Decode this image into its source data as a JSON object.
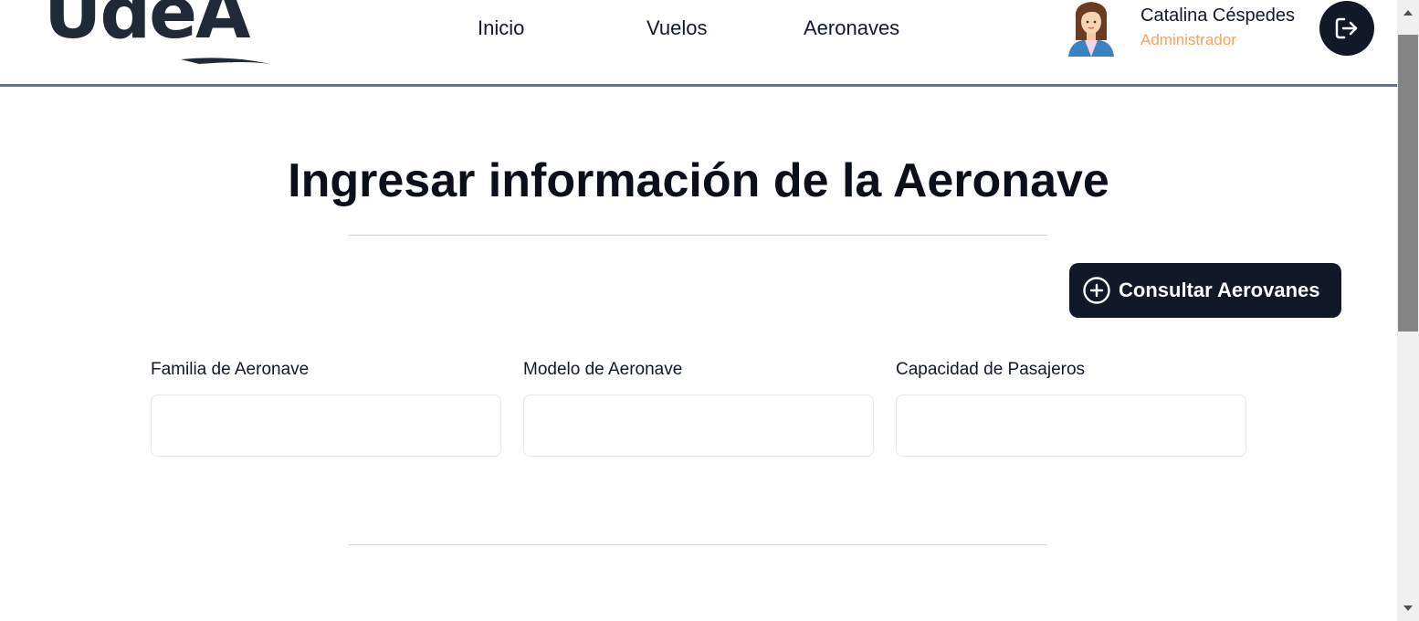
{
  "header": {
    "logo_text": "UdeA",
    "nav": {
      "inicio": "Inicio",
      "vuelos": "Vuelos",
      "aeronaves": "Aeronaves"
    },
    "user": {
      "name": "Catalina Céspedes",
      "role": "Administrador"
    },
    "logout_icon": "logout-icon"
  },
  "main": {
    "title": "Ingresar información de la Aeronave",
    "consult_button": {
      "label": "Consultar Aerovanes",
      "icon": "plus-circle-icon"
    },
    "fields": [
      {
        "label": "Familia de Aeronave",
        "value": "",
        "placeholder": ""
      },
      {
        "label": "Modelo de Aeronave",
        "value": "",
        "placeholder": ""
      },
      {
        "label": "Capacidad de Pasajeros",
        "value": "",
        "placeholder": ""
      }
    ]
  },
  "colors": {
    "primary_dark": "#111827",
    "role_accent": "#f4a261",
    "header_border": "#6b7280"
  }
}
